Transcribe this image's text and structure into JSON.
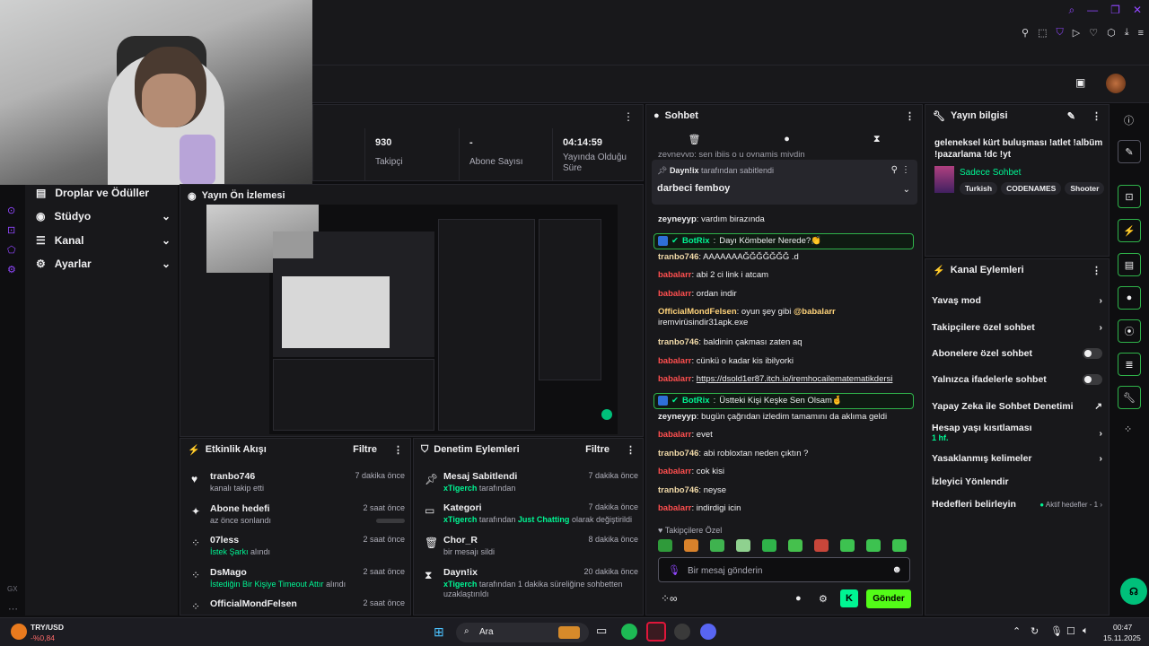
{
  "colors": {
    "accent": "#9147ff",
    "green": "#00f593",
    "bot_border": "#2fb34a",
    "bg": "#0e0e10",
    "panel": "#18181b"
  },
  "stats": [
    {
      "value": "930",
      "label": "Takipçi"
    },
    {
      "value": "-",
      "label": "Abone Sayısı"
    },
    {
      "value": "04:14:59",
      "label": "Yayında Olduğu Süre"
    }
  ],
  "nav": {
    "items": [
      {
        "label": "Droplar ve Ödüller",
        "icon": "drops-icon"
      },
      {
        "label": "Stüdyo",
        "icon": "studio-icon"
      },
      {
        "label": "Kanal",
        "icon": "channel-icon"
      },
      {
        "label": "Ayarlar",
        "icon": "gear-icon"
      }
    ],
    "footer": "GX"
  },
  "preview": {
    "title": "Yayın Ön İzlemesi"
  },
  "activity": {
    "title": "Etkinlik Akışı",
    "filter": "Filtre",
    "items": [
      {
        "user": "tranbo746",
        "desc": "kanalı takip etti",
        "time": "7 dakika önce",
        "icon": "heart-icon"
      },
      {
        "user": "Abone hedefi",
        "desc": "az önce sonlandı",
        "time": "2 saat önce",
        "icon": "sparkle-icon"
      },
      {
        "user": "07less",
        "desc": "İstek Şarkı",
        "desc2": "alındı",
        "time": "2 saat önce",
        "icon": "points-icon"
      },
      {
        "user": "DsMago",
        "desc": "İstediğin Bir Kişiye Timeout Attır",
        "desc2": "alındı",
        "time": "2 saat önce",
        "icon": "points-icon"
      },
      {
        "user": "OfficialMondFelsen",
        "desc": "",
        "time": "2 saat önce",
        "icon": "points-icon"
      }
    ]
  },
  "moderation": {
    "title": "Denetim Eylemleri",
    "filter": "Filtre",
    "items": [
      {
        "title": "Mesaj Sabitlendi",
        "user": "xTigerch",
        "desc": "tarafından",
        "time": "7 dakika önce",
        "icon": "pin-icon"
      },
      {
        "title": "Kategori",
        "user": "xTigerch",
        "desc": "tarafından",
        "extra": "Just Chatting",
        "desc2": "olarak değiştirildi",
        "time": "7 dakika önce",
        "icon": "category-icon"
      },
      {
        "title": "Chor_R",
        "user": "",
        "desc": "bir mesajı sildi",
        "time": "8 dakika önce",
        "icon": "trash-icon"
      },
      {
        "title": "Dayn!ix",
        "user": "xTigerch",
        "desc": "tarafından 1 dakika süreliğine sohbetten uzaklaştırıldı",
        "time": "20 dakika önce",
        "icon": "hourglass-icon"
      }
    ]
  },
  "chat": {
    "title": "Sohbet",
    "pinned_by": "Dayn!ix",
    "pinned_by_suffix": "tarafından sabitlendi",
    "pinned_text": "darbeci femboy",
    "top_cut": "zeyneyyp: sen ibiis o u oynamis miydin",
    "messages": [
      {
        "user": "zeyneyyp",
        "color": "#efeff1",
        "text": "vardım birazında"
      },
      {
        "user": "BotRix",
        "color": "#00f593",
        "text": "Dayı Kömbeler Nerede?👏",
        "bot": true
      },
      {
        "user": "tranbo746",
        "color": "#f0d9a8",
        "text": "AAAAAAAĞĞĞĞĞĞĞ .d"
      },
      {
        "user": "babalarr",
        "color": "#ff4f4f",
        "text": "abi 2 ci link i atcam"
      },
      {
        "user": "babalarr",
        "color": "#ff4f4f",
        "text": "ordan indir"
      },
      {
        "user": "OfficialMondFelsen",
        "color": "#ffd37a",
        "text": "oyun şey gibi ",
        "mention": "@babalarr",
        "text2": "iremvirüsindir31apk.exe"
      },
      {
        "user": "tranbo746",
        "color": "#f0d9a8",
        "text": "baldinin çakması zaten aq"
      },
      {
        "user": "babalarr",
        "color": "#ff4f4f",
        "text": "cünkü o kadar kis ibilyorki"
      },
      {
        "user": "babalarr",
        "color": "#ff4f4f",
        "text": "https://dsold1er87.itch.io/iremhocailematematikdersi",
        "link": true
      },
      {
        "user": "BotRix",
        "color": "#00f593",
        "text": "Üstteki Kişi Keşke Sen Olsam🤞",
        "bot": true
      },
      {
        "user": "zeyneyyp",
        "color": "#efeff1",
        "text": "bugün çağrıdan izledim tamamını da aklıma geldi"
      },
      {
        "user": "babalarr",
        "color": "#ff4f4f",
        "text": "evet"
      },
      {
        "user": "tranbo746",
        "color": "#f0d9a8",
        "text": "abi robloxtan neden çıktın ?"
      },
      {
        "user": "babalarr",
        "color": "#ff4f4f",
        "text": "cok kisi"
      },
      {
        "user": "tranbo746",
        "color": "#f0d9a8",
        "text": "neyse"
      },
      {
        "user": "babalarr",
        "color": "#ff4f4f",
        "text": "indirdigi icin"
      }
    ],
    "follower_only": "Takipçilere Özel",
    "input_placeholder": "Bir mesaj gönderin",
    "send": "Gönder"
  },
  "info": {
    "title": "Yayın bilgisi",
    "stream_title": "geleneksel kürt buluşması !atlet !albüm !pazarlama !dc !yt",
    "category": "Sadece Sohbet",
    "tags": [
      "Turkish",
      "CODENAMES",
      "Shooter"
    ]
  },
  "actions": {
    "title": "Kanal Eylemleri",
    "items": [
      {
        "label": "Yavaş mod",
        "kind": "chevron"
      },
      {
        "label": "Takipçilere özel sohbet",
        "kind": "chevron"
      },
      {
        "label": "Abonelere özel sohbet",
        "kind": "toggle"
      },
      {
        "label": "Yalnızca ifadelerle sohbet",
        "kind": "toggle"
      },
      {
        "label": "Yapay Zeka ile Sohbet Denetimi",
        "kind": "external"
      },
      {
        "label": "Hesap yaşı kısıtlaması",
        "sub": "1 hf.",
        "kind": "chevron"
      },
      {
        "label": "Yasaklanmış kelimeler",
        "kind": "chevron"
      },
      {
        "label": "İzleyici Yönlendir",
        "kind": "none"
      },
      {
        "label": "Hedefleri belirleyin",
        "status": "Aktif hedefler - 1",
        "kind": "chevron"
      }
    ]
  },
  "taskbar": {
    "currency": "TRY/USD",
    "change": "-%0,84",
    "search": "Ara",
    "time": "00:47",
    "date": "15.11.2025"
  }
}
